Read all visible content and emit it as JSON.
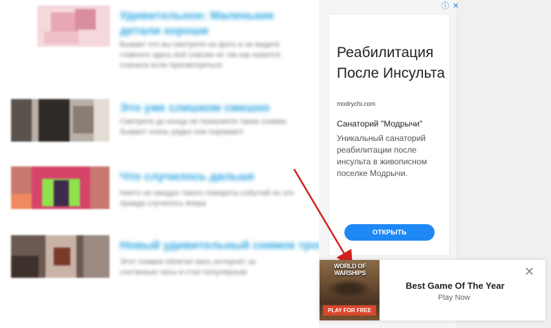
{
  "feed": {
    "items": [
      {
        "headline": "Удивительное: Маленькие детали хороши",
        "body": "Бывает что вы смотрите на фото и не видите главного здесь всё совсем не так как кажется сначала если присмотреться"
      },
      {
        "headline": "Это уже слишком смешно",
        "body": "Смотрите до конца не пожалеете такие снимки бывают очень редко они поражают"
      },
      {
        "headline": "Что случилось дальше",
        "body": "Никто не ожидал такого поворота событий но это правда случилось вчера"
      },
      {
        "headline": "Новый удивительный снимок трогательный",
        "body": "Этот снимок облетел весь интернет за считанные часы и стал популярным"
      }
    ]
  },
  "ad": {
    "title": "Реабилитация После Инсульта",
    "domain": "modrychi.com",
    "name": "Санаторий \"Модрычи\"",
    "description": "Уникальный санаторий реабилитации после инсульта в живописном поселке Модрычи.",
    "button_label": "ОТКРЫТЬ",
    "info_icon": "ⓘ",
    "close_icon": "✕"
  },
  "popup": {
    "game_logo": "WORLD OF WARSHIPS",
    "game_cta": "PLAY FOR FREE",
    "title": "Best Game Of The Year",
    "subtitle": "Play Now",
    "close_icon": "✕"
  },
  "colors": {
    "accent_blue": "#1e88f5",
    "arrow_red": "#d32020",
    "link_blue": "#2aa5e0"
  }
}
